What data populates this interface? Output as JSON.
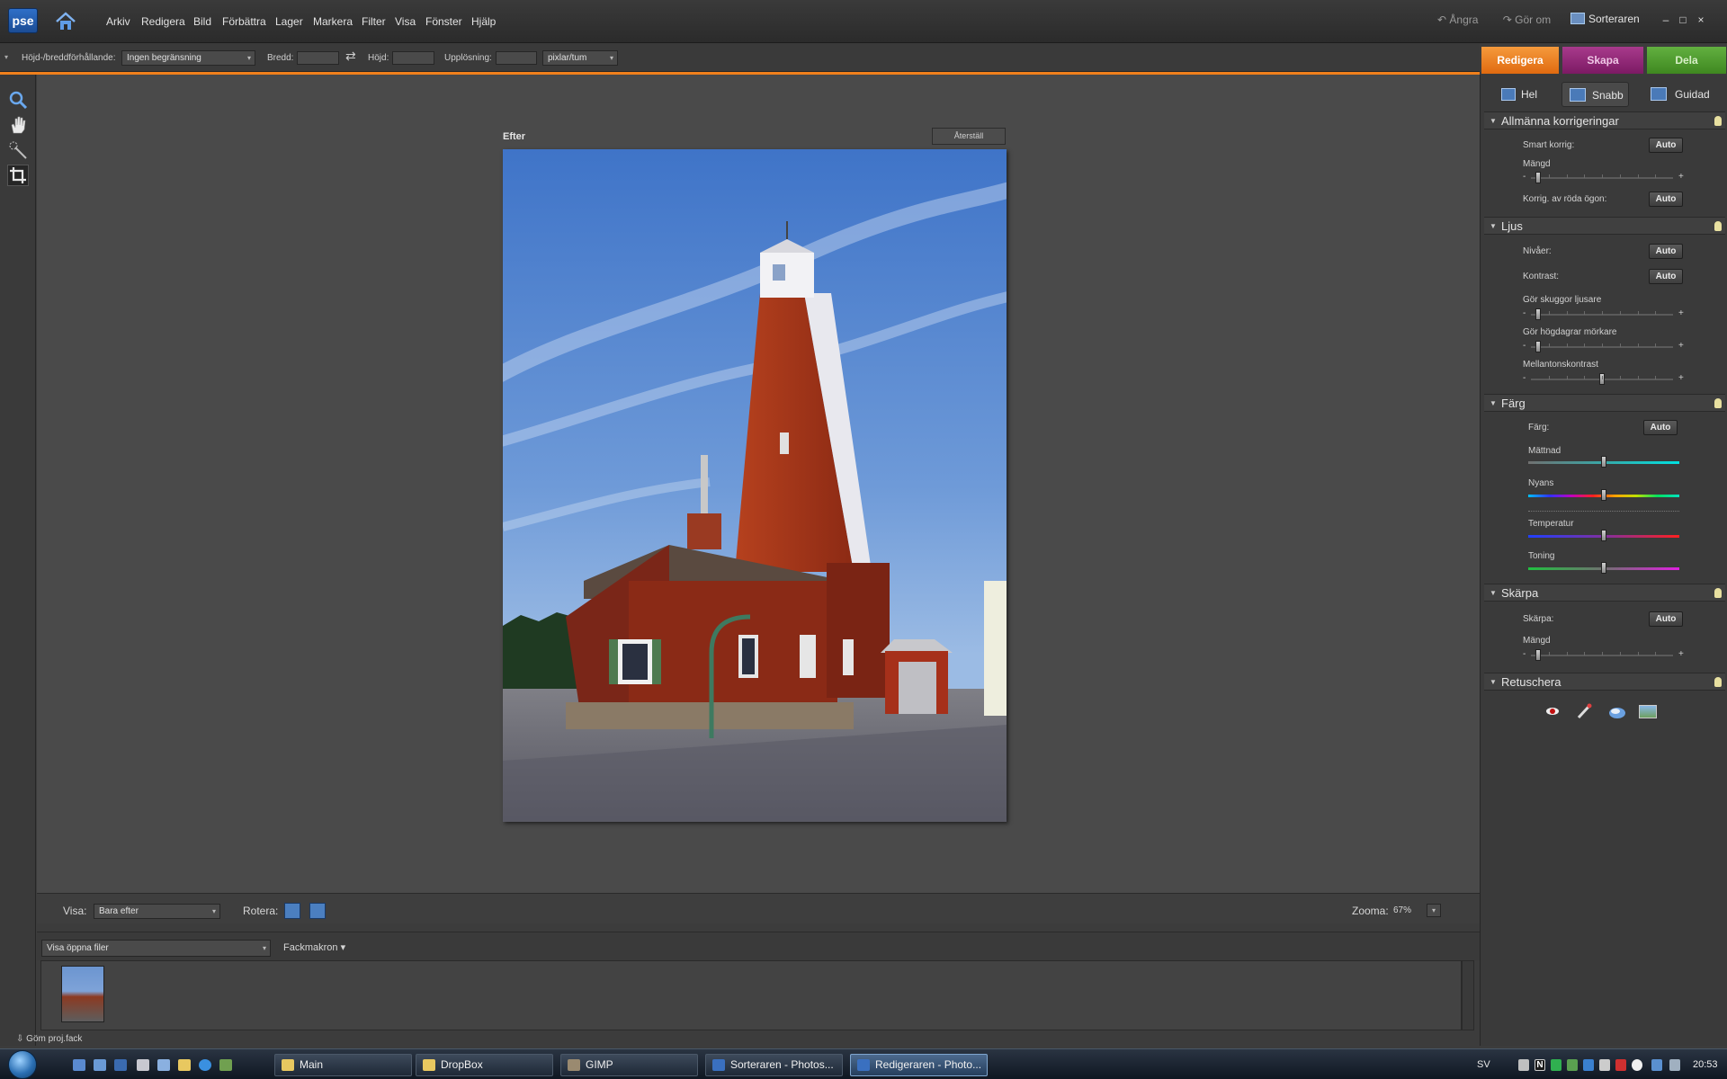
{
  "app": {
    "logo": "pse"
  },
  "menu": [
    "Arkiv",
    "Redigera",
    "Bild",
    "Förbättra",
    "Lager",
    "Markera",
    "Filter",
    "Visa",
    "Fönster",
    "Hjälp"
  ],
  "titlebar": {
    "undo": "Ångra",
    "redo": "Gör om",
    "organizer": "Sorteraren"
  },
  "options": {
    "aspect_label": "Höjd-/breddförhållande:",
    "aspect_value": "Ingen begränsning",
    "width_label": "Bredd:",
    "height_label": "Höjd:",
    "resolution_label": "Upplösning:",
    "resolution_unit": "pixlar/tum"
  },
  "mode_tabs": [
    {
      "label": "Redigera",
      "color": "#f07c1c"
    },
    {
      "label": "Skapa",
      "color": "#9a2a7c"
    },
    {
      "label": "Dela",
      "color": "#55a030"
    }
  ],
  "sub_tabs": [
    "Hel",
    "Snabb",
    "Guidad"
  ],
  "canvas": {
    "view_label": "Efter",
    "reset_button": "Återställ"
  },
  "viewbar": {
    "view_label": "Visa:",
    "view_value": "Bara efter",
    "rotate_label": "Rotera:",
    "zoom_label": "Zooma:",
    "zoom_value": "67%"
  },
  "bin": {
    "dropdown": "Visa öppna filer",
    "macros": "Fackmakron",
    "hide_label": "Göm proj.fack"
  },
  "panel": {
    "general": {
      "title": "Allmänna korrigeringar",
      "smart_fix": "Smart korrig:",
      "amount": "Mängd",
      "amount_level": 0.03,
      "red_eye": "Korrig. av röda ögon:",
      "auto": "Auto"
    },
    "light": {
      "title": "Ljus",
      "levels": "Nivåer:",
      "contrast": "Kontrast:",
      "lighten_shadows": "Gör skuggor ljusare",
      "lighten_shadows_level": 0.03,
      "darken_highlights": "Gör högdagrar mörkare",
      "darken_highlights_level": 0.03,
      "midtone": "Mellantonskontrast",
      "midtone_level": 0.5
    },
    "color": {
      "title": "Färg",
      "color_label": "Färg:",
      "saturation": "Mättnad",
      "saturation_level": 0.5,
      "hue": "Nyans",
      "hue_level": 0.5,
      "temperature": "Temperatur",
      "temperature_level": 0.5,
      "tint": "Toning",
      "tint_level": 0.5
    },
    "sharpness": {
      "title": "Skärpa",
      "label": "Skärpa:",
      "amount": "Mängd",
      "amount_level": 0.03
    },
    "retouch": {
      "title": "Retuschera"
    },
    "minus": "-",
    "plus": "+"
  },
  "taskbar": {
    "buttons": [
      "Main",
      "DropBox",
      "GIMP",
      "Sorteraren - Photos...",
      "Redigeraren - Photo..."
    ],
    "lang": "SV",
    "clock": "20:53"
  }
}
